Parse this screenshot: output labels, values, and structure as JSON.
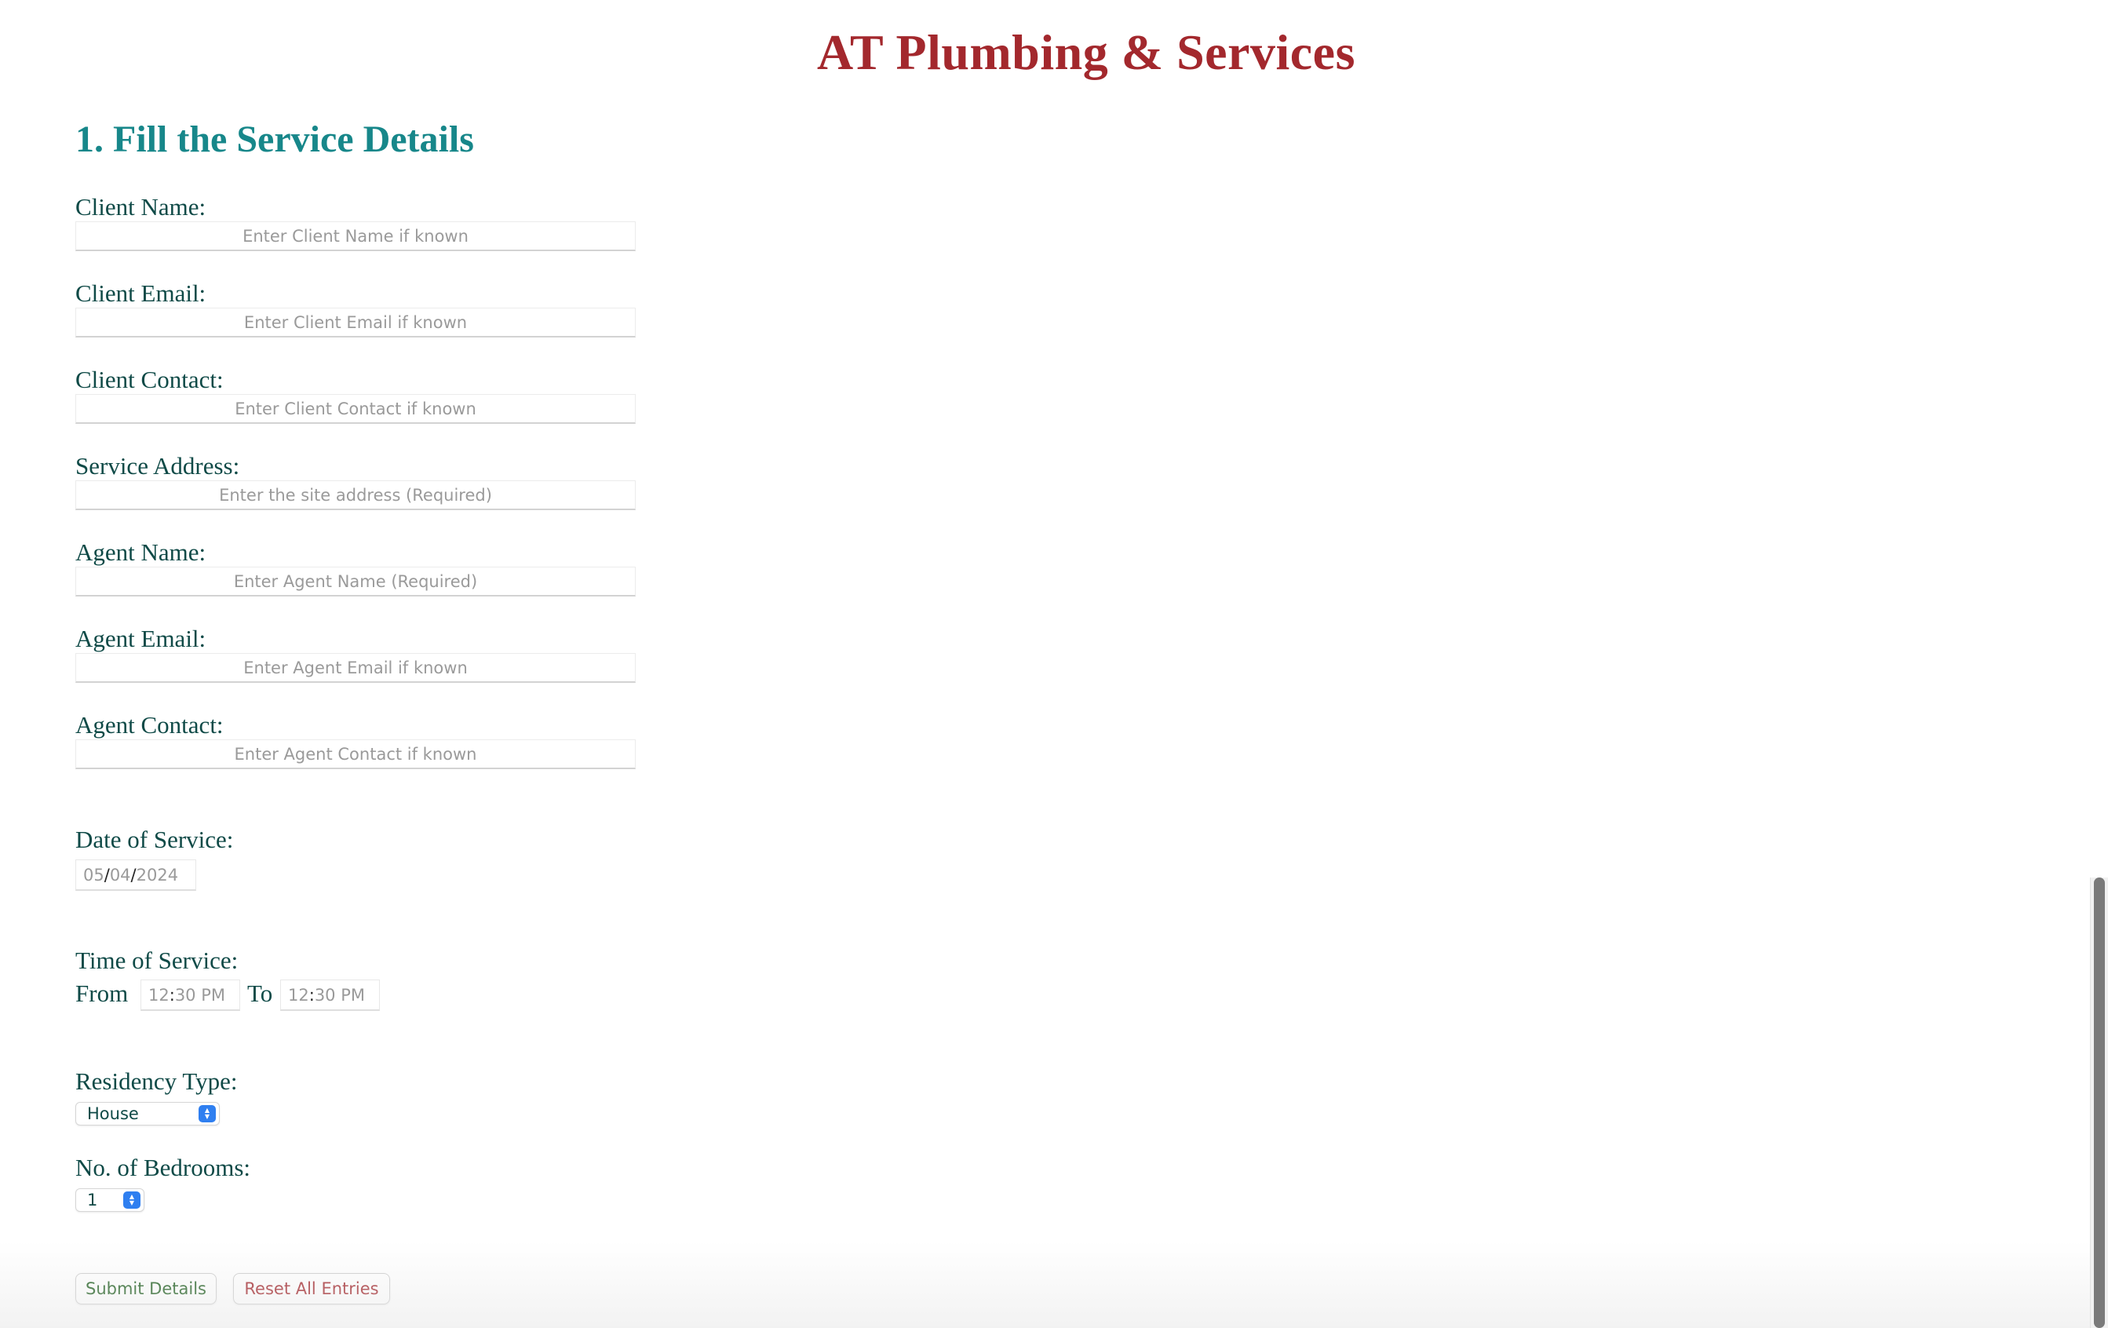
{
  "header": {
    "title": "AT Plumbing & Services"
  },
  "section": {
    "title": "1. Fill the Service Details"
  },
  "form": {
    "client_name": {
      "label": "Client Name:",
      "placeholder": "Enter Client Name if known"
    },
    "client_email": {
      "label": "Client Email:",
      "placeholder": "Enter Client Email if known"
    },
    "client_contact": {
      "label": "Client Contact:",
      "placeholder": "Enter Client Contact if known"
    },
    "service_address": {
      "label": "Service Address:",
      "placeholder": "Enter the site address (Required)"
    },
    "agent_name": {
      "label": "Agent Name:",
      "placeholder": "Enter Agent Name (Required)"
    },
    "agent_email": {
      "label": "Agent Email:",
      "placeholder": "Enter Agent Email if known"
    },
    "agent_contact": {
      "label": "Agent Contact:",
      "placeholder": "Enter Agent Contact if known"
    },
    "date_of_service": {
      "label": "Date of Service:",
      "month": "05",
      "day": "04",
      "year": "2024",
      "separator": "/"
    },
    "time_of_service": {
      "label": "Time of Service:",
      "from_label": "From",
      "to_label": "To",
      "from": {
        "hour": "12",
        "minute": "30",
        "period": "PM"
      },
      "to": {
        "hour": "12",
        "minute": "30",
        "period": "PM"
      },
      "separator": ":"
    },
    "residency_type": {
      "label": "Residency Type:",
      "selected": "House"
    },
    "bedrooms": {
      "label": "No. of Bedrooms:",
      "selected": "1"
    }
  },
  "buttons": {
    "submit": "Submit Details",
    "reset": "Reset All Entries"
  },
  "colors": {
    "title": "#a3282d",
    "section": "#17878a",
    "label": "#0f4a47",
    "select_accent": "#2f7ff0"
  },
  "icons": {
    "select_arrow": "chevron-up-down-icon"
  }
}
